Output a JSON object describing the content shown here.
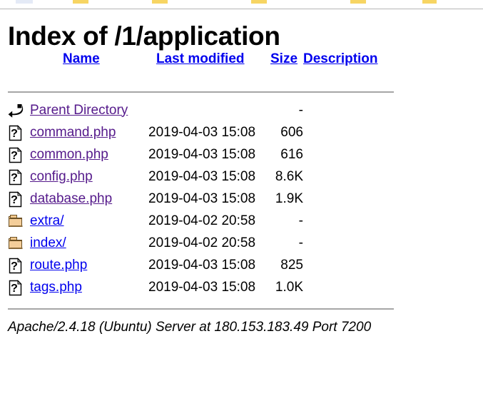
{
  "browser_chrome": {
    "tab_marks": [
      "mark-0",
      "mark-1",
      "mark-2",
      "mark-3",
      "mark-4",
      "mark-5"
    ]
  },
  "page": {
    "title": "Index of /1/application",
    "directory_path": "/1/application"
  },
  "colors": {
    "link_unvisited": "#0000EE",
    "link_visited": "#551A8B",
    "text": "#000000",
    "rule": "#A6A6A6",
    "folder_icon": "#F2C78C",
    "background": "#FFFFFF"
  },
  "table": {
    "headers": [
      {
        "label": "Name",
        "name": "column-header-name"
      },
      {
        "label": "Last modified",
        "name": "column-header-last-modified"
      },
      {
        "label": "Size",
        "name": "column-header-size"
      },
      {
        "label": "Description",
        "name": "column-header-description"
      }
    ],
    "rows": [
      {
        "icon": "back-icon",
        "name": "Parent Directory",
        "last_modified": "",
        "size": "-",
        "description": "",
        "link_state": "visited",
        "kind": "parent"
      },
      {
        "icon": "unknown-file-icon",
        "name": "command.php",
        "last_modified": "2019-04-03 15:08",
        "size": "606",
        "description": "",
        "link_state": "visited",
        "kind": "file"
      },
      {
        "icon": "unknown-file-icon",
        "name": "common.php",
        "last_modified": "2019-04-03 15:08",
        "size": "616",
        "description": "",
        "link_state": "visited",
        "kind": "file"
      },
      {
        "icon": "unknown-file-icon",
        "name": "config.php",
        "last_modified": "2019-04-03 15:08",
        "size": "8.6K",
        "description": "",
        "link_state": "visited",
        "kind": "file"
      },
      {
        "icon": "unknown-file-icon",
        "name": "database.php",
        "last_modified": "2019-04-03 15:08",
        "size": "1.9K",
        "description": "",
        "link_state": "visited",
        "kind": "file"
      },
      {
        "icon": "folder-icon",
        "name": "extra/",
        "last_modified": "2019-04-02 20:58",
        "size": "-",
        "description": "",
        "link_state": "unvisited",
        "kind": "directory"
      },
      {
        "icon": "folder-icon",
        "name": "index/",
        "last_modified": "2019-04-02 20:58",
        "size": "-",
        "description": "",
        "link_state": "unvisited",
        "kind": "directory"
      },
      {
        "icon": "unknown-file-icon",
        "name": "route.php",
        "last_modified": "2019-04-03 15:08",
        "size": "825",
        "description": "",
        "link_state": "unvisited",
        "kind": "file"
      },
      {
        "icon": "unknown-file-icon",
        "name": "tags.php",
        "last_modified": "2019-04-03 15:08",
        "size": "1.0K",
        "description": "",
        "link_state": "unvisited",
        "kind": "file"
      }
    ]
  },
  "footer": {
    "address": "Apache/2.4.18 (Ubuntu) Server at 180.153.183.49 Port 7200",
    "server_software": "Apache/2.4.18",
    "os": "Ubuntu",
    "host": "180.153.183.49",
    "port": "7200"
  }
}
